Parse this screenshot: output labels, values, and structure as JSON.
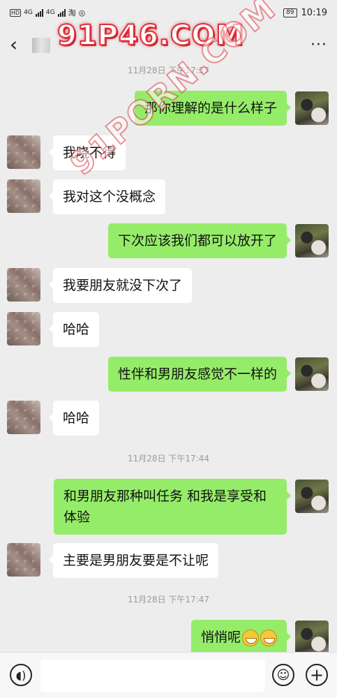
{
  "status_bar": {
    "network_tags": [
      "HD",
      "HD"
    ],
    "signal_1": "4G",
    "signal_2": "4G",
    "battery": "89",
    "clock": "10:19"
  },
  "header": {
    "back_icon": "chevron-left-icon",
    "more_label": "···"
  },
  "watermark": {
    "main": "91P46.COM",
    "diagonal": "91PORN.COM"
  },
  "messages": [
    {
      "type": "time",
      "text": "11月28日 下午17:37"
    },
    {
      "type": "out",
      "text": "那你理解的是什么样子"
    },
    {
      "type": "in",
      "text": "我晓不得"
    },
    {
      "type": "in",
      "text": "我对这个没概念"
    },
    {
      "type": "out",
      "text": "下次应该我们都可以放开了"
    },
    {
      "type": "in",
      "text": "我要朋友就没下次了"
    },
    {
      "type": "in",
      "text": "哈哈"
    },
    {
      "type": "out",
      "text": "性伴和男朋友感觉不一样的"
    },
    {
      "type": "in",
      "text": "哈哈"
    },
    {
      "type": "time",
      "text": "11月28日 下午17:44"
    },
    {
      "type": "out",
      "text": "和男朋友那种叫任务 和我是享受和体验"
    },
    {
      "type": "in",
      "text": "主要是男朋友要是不让呢"
    },
    {
      "type": "time",
      "text": "11月28日 下午17:47"
    },
    {
      "type": "out",
      "text": "悄悄呢"
    }
  ],
  "input_bar": {
    "voice_icon": "voice-icon",
    "emoji_icon": "emoji-icon",
    "plus_icon": "plus-icon"
  }
}
